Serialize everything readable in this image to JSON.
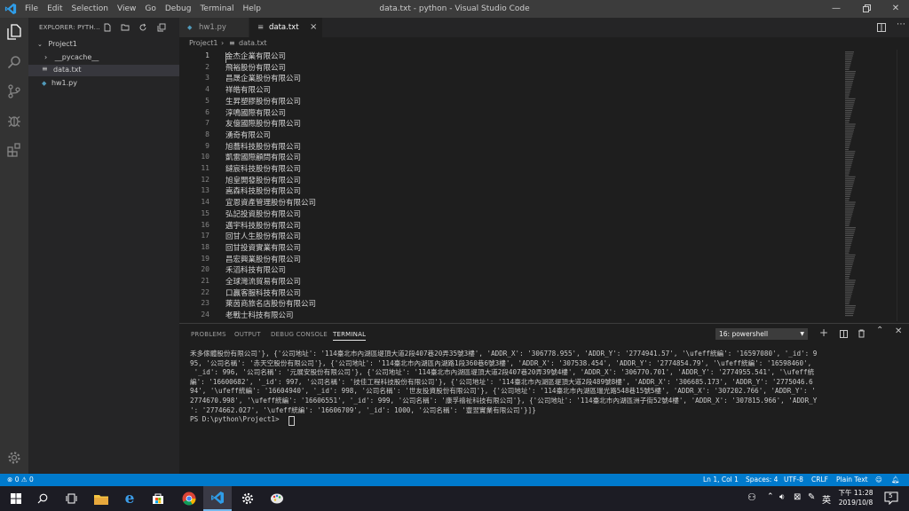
{
  "titlebar": {
    "menu": [
      "File",
      "Edit",
      "Selection",
      "View",
      "Go",
      "Debug",
      "Terminal",
      "Help"
    ],
    "title": "data.txt - python - Visual Studio Code"
  },
  "sidebar": {
    "header": "EXPLORER: PYTH...",
    "project": "Project1",
    "items": [
      {
        "label": "__pycache__",
        "icon": "chevron-right-icon"
      },
      {
        "label": "data.txt",
        "icon": "text-file-icon"
      },
      {
        "label": "hw1.py",
        "icon": "python-file-icon"
      }
    ]
  },
  "tabs": [
    {
      "label": "hw1.py",
      "icon": "python-file-icon"
    },
    {
      "label": "data.txt",
      "icon": "text-file-icon",
      "close": "×"
    }
  ],
  "breadcrumb": {
    "root": "Project1",
    "sep": "›",
    "file": "data.txt"
  },
  "editor": {
    "lines": [
      {
        "n": "1",
        "t": "金杰企業有限公司"
      },
      {
        "n": "2",
        "t": "飛裕股份有限公司"
      },
      {
        "n": "3",
        "t": "昌晟企業股份有限公司"
      },
      {
        "n": "4",
        "t": "祥皓有限公司"
      },
      {
        "n": "5",
        "t": "生昇塑膠股份有限公司"
      },
      {
        "n": "6",
        "t": "淳鳴國際有限公司"
      },
      {
        "n": "7",
        "t": "友億國際股份有限公司"
      },
      {
        "n": "8",
        "t": "湧奇有限公司"
      },
      {
        "n": "9",
        "t": "旭蕎科技股份有限公司"
      },
      {
        "n": "10",
        "t": "凱雷國際顧問有限公司"
      },
      {
        "n": "11",
        "t": "鐽宸科技股份有限公司"
      },
      {
        "n": "12",
        "t": "旭皇開發股份有限公司"
      },
      {
        "n": "13",
        "t": "嵩森科技股份有限公司"
      },
      {
        "n": "14",
        "t": "宜恩資產管理股份有限公司"
      },
      {
        "n": "15",
        "t": "弘記投資股份有限公司"
      },
      {
        "n": "16",
        "t": "邁宇科技股份有限公司"
      },
      {
        "n": "17",
        "t": "回甘人生股份有限公司"
      },
      {
        "n": "18",
        "t": "回甘投資實業有限公司"
      },
      {
        "n": "19",
        "t": "昌宏興業股份有限公司"
      },
      {
        "n": "20",
        "t": "禾滔科技有限公司"
      },
      {
        "n": "21",
        "t": "全球灣流貿易有限公司"
      },
      {
        "n": "22",
        "t": "口贏客服科技有限公司"
      },
      {
        "n": "23",
        "t": "萊茵商旅名店股份有限公司"
      },
      {
        "n": "24",
        "t": "老戰士科技有限公司"
      }
    ]
  },
  "panel": {
    "tabs": [
      "PROBLEMS",
      "OUTPUT",
      "DEBUG CONSOLE",
      "TERMINAL"
    ],
    "terminal_select": "16: powershell",
    "terminal_lines": [
      "禾多傢體股份有限公司'}, {'公司地址': '114臺北市內湖區堤頂大道2段407巷20弄35號3樓', 'ADDR_X': '306778.955', 'ADDR_Y': '2774941.57', '\\ufeff統編': '16597080', '_id': 9",
      "95, '公司名稱': '赤天空股份有限公司'}, {'公司地址': '114臺北市內湖區內湖路1段360巷6號3樓', 'ADDR_X': '307538.454', 'ADDR_Y': '2774854.79', '\\ufeff統編': '16598460',",
      " '_id': 996, '公司名稱': '元展安股份有限公司'}, {'公司地址': '114臺北市內湖區堤頂大道2段407巷20弄39號4樓', 'ADDR_X': '306770.701', 'ADDR_Y': '2774955.541', '\\ufeff統",
      "編': '16600682', '_id': 997, '公司名稱': '技佳工程科技股份有限公司'}, {'公司地址': '114臺北市內湖區堤頂大道2段489號8樓', 'ADDR_X': '306685.173', 'ADDR_Y': '2775046.6",
      "94', '\\ufeff統編': '16604940', '_id': 998, '公司名稱': '世友投資股份有限公司'}, {'公司地址': '114臺北市內湖區瑞光路548巷15號5樓', 'ADDR_X': '307202.766', 'ADDR_Y': '",
      "2774670.998', '\\ufeff統編': '16606551', '_id': 999, '公司名稱': '康孚禧祉科技有限公司'}, {'公司地址': '114臺北市內湖區洲子街52號4樓', 'ADDR_X': '307815.966', 'ADDR_Y",
      "': '2774662.027', '\\ufeff統編': '16606709', '_id': 1000, '公司名稱': '豐翌實業有限公司'}]}",
      "PS D:\\python\\Project1> "
    ]
  },
  "statusbar": {
    "errors": "0",
    "warnings": "0",
    "position": "Ln 1, Col 1",
    "spaces": "Spaces: 4",
    "encoding": "UTF-8",
    "eol": "CRLF",
    "language": "Plain Text"
  },
  "taskbar": {
    "time": "下午 11:28",
    "date": "2019/10/8",
    "ime": "英",
    "notifications": "5"
  },
  "colors": {
    "accent": "#007acc",
    "titlebar": "#3c3c3c",
    "activitybar": "#333333",
    "sidebar": "#252526",
    "editor": "#1e1e1e"
  }
}
